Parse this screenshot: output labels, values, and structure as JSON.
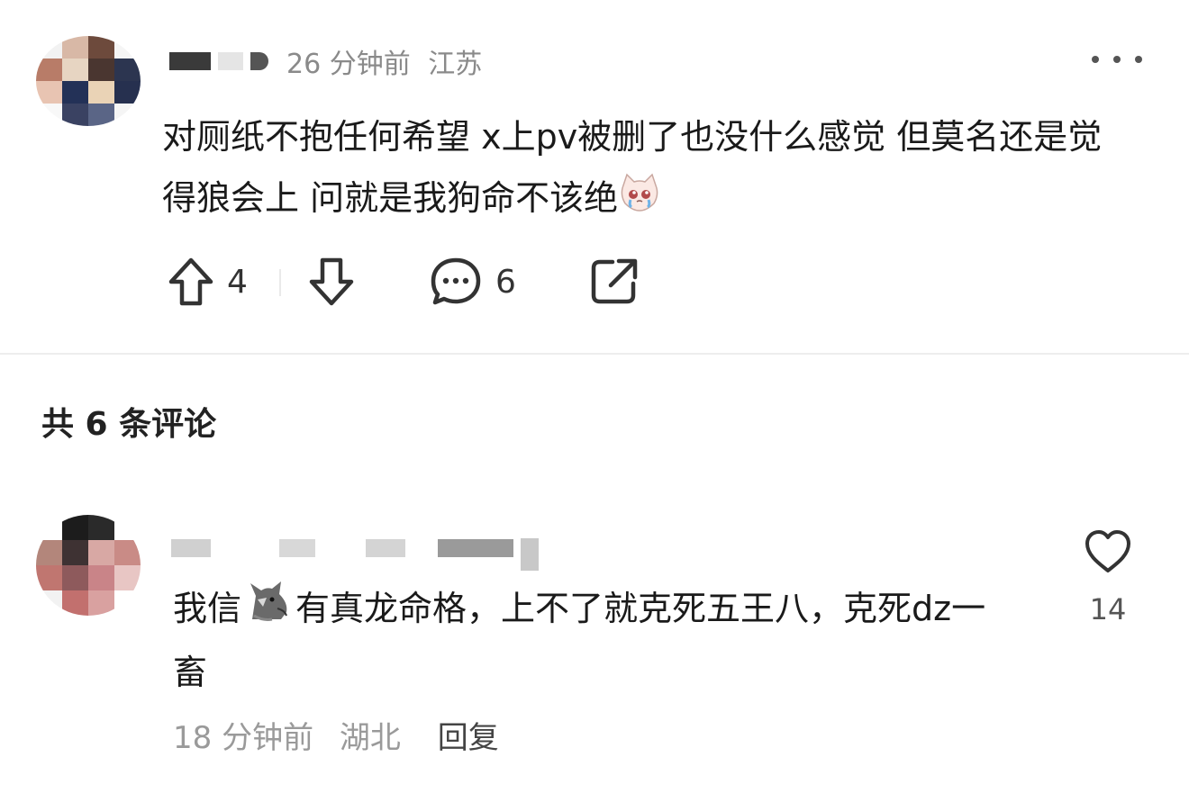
{
  "post": {
    "time": "26 分钟前",
    "location": "江苏",
    "text_main": "对厕纸不抱任何希望 x上pv被删了也没什么感觉 但莫名还是觉得狼会上 问就是我狗命不该绝",
    "emoji": "crying-cat-emoji",
    "upvotes": "4",
    "comments": "6"
  },
  "comments_header": "共 6 条评论",
  "reply": {
    "text_before": "我信",
    "emoji": "wolf-emoji",
    "text_after": "有真龙命格，上不了就克死五王八，克死dz一畜",
    "time": "18 分钟前",
    "location": "湖北",
    "reply_label": "回复",
    "likes": "14"
  },
  "colors": {
    "text": "#1a1a1a",
    "meta": "#8a8a8a",
    "separator": "#ededed"
  }
}
